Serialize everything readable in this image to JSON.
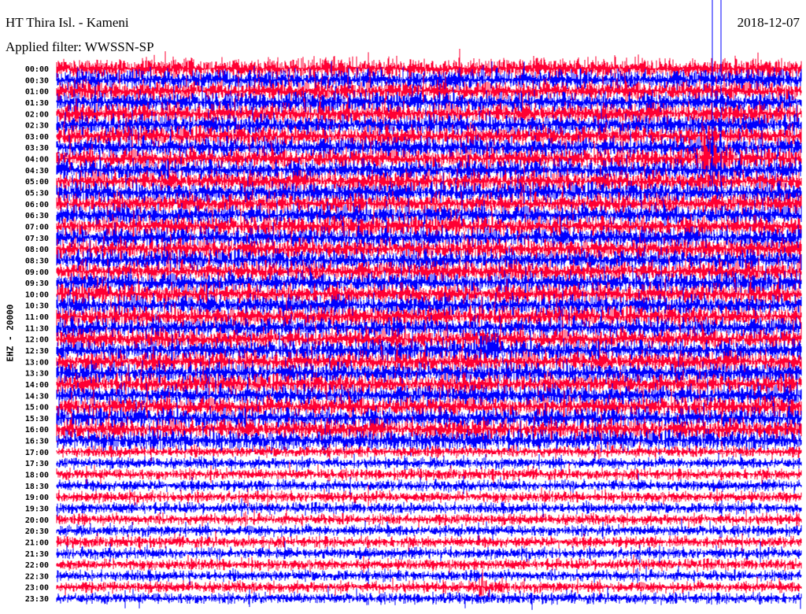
{
  "header": {
    "station": "HT Thira Isl. - Kameni",
    "filter": "Applied filter: WWSSN-SP",
    "date": "2018-12-07",
    "channel": "EHZ - 20000"
  },
  "chart_data": {
    "type": "line",
    "title": "HT Thira Isl. - Kameni",
    "subtitle": "Applied filter: WWSSN-SP",
    "ylabel": "EHZ - 20000",
    "row_labels": [
      "00:00",
      "00:30",
      "01:00",
      "01:30",
      "02:00",
      "02:30",
      "03:00",
      "03:30",
      "04:00",
      "04:30",
      "05:00",
      "05:30",
      "06:00",
      "06:30",
      "07:00",
      "07:30",
      "08:00",
      "08:30",
      "09:00",
      "09:30",
      "10:00",
      "10:30",
      "11:00",
      "11:30",
      "12:00",
      "12:30",
      "13:00",
      "13:30",
      "14:00",
      "14:30",
      "15:00",
      "15:30",
      "16:00",
      "16:30",
      "17:00",
      "17:30",
      "18:00",
      "18:30",
      "19:00",
      "19:30",
      "20:00",
      "20:30",
      "21:00",
      "21:30",
      "22:00",
      "22:30",
      "23:00",
      "23:30"
    ],
    "row_minutes": 30,
    "series_colors": [
      "#ff0033",
      "#0000ff"
    ],
    "relative_noise_amplitude": {
      "00:00-16:30": 1.0,
      "17:00-23:30": 0.45
    },
    "events": [
      {
        "row": "04:00",
        "minute": 26,
        "relative_amplitude": 3.0
      },
      {
        "row": "12:30",
        "minute": 17,
        "relative_amplitude": 1.5
      },
      {
        "row": "23:00",
        "minute": 17,
        "relative_amplitude": 2.0
      }
    ]
  }
}
